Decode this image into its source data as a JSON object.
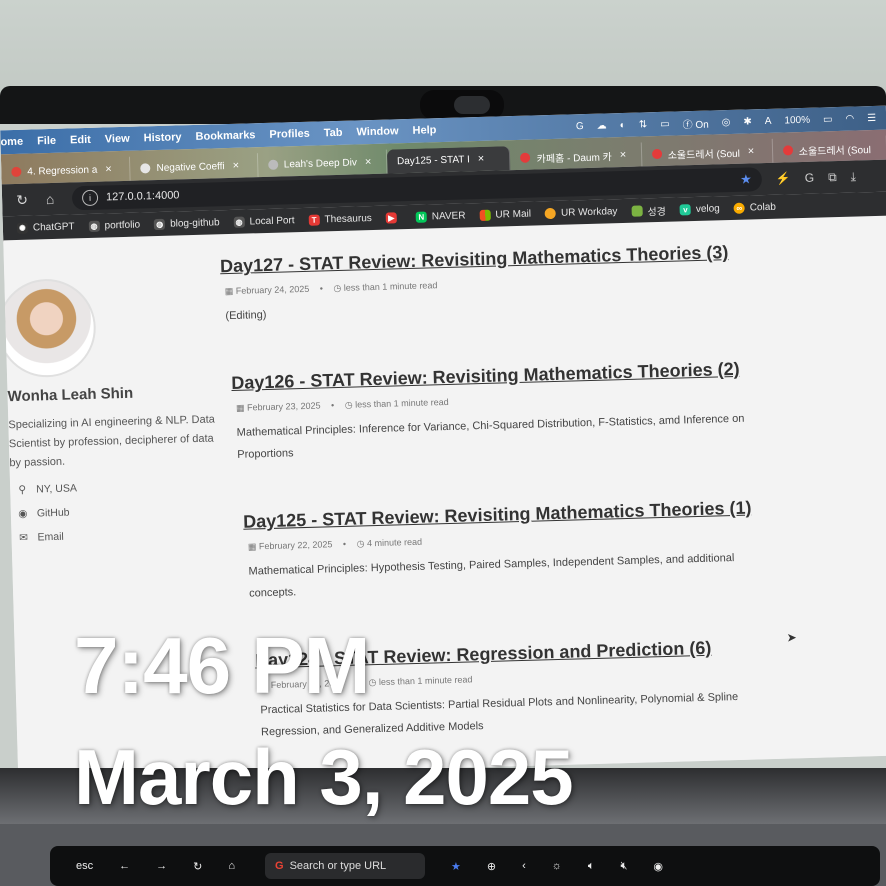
{
  "menu": [
    "ome",
    "File",
    "Edit",
    "View",
    "History",
    "Bookmarks",
    "Profiles",
    "Tab",
    "Window",
    "Help"
  ],
  "status": {
    "on": "On",
    "battery": "100%"
  },
  "tabs": [
    {
      "label": "4. Regression a",
      "color": "#e0443a"
    },
    {
      "label": "Negative Coeffi",
      "color": "#e6e6e6"
    },
    {
      "label": "Leah's Deep Div",
      "color": "#bbbbbb"
    },
    {
      "label": "Day125 - STAT I",
      "color": "#3a3b3d"
    },
    {
      "label": "카페홈 - Daum 카",
      "color": "#e33b3b"
    },
    {
      "label": "소울드레서 (Soul",
      "color": "#e33b3b"
    },
    {
      "label": "소울드레서 (Soul",
      "color": "#e33b3b"
    }
  ],
  "url": "127.0.0.1:4000",
  "bookmarks": [
    {
      "label": "ChatGPT",
      "icon": "chatgpt-icon",
      "color": "#333333"
    },
    {
      "label": "portfolio",
      "icon": "globe-icon",
      "color": "#555555"
    },
    {
      "label": "blog-github",
      "icon": "globe-icon",
      "color": "#555555"
    },
    {
      "label": "Local Port",
      "icon": "globe-icon",
      "color": "#555555"
    },
    {
      "label": "Thesaurus",
      "icon": "thesaurus-icon",
      "color": "#e53935"
    },
    {
      "label": "",
      "icon": "youtube-icon",
      "color": "#e53935"
    },
    {
      "label": "NAVER",
      "icon": "naver-icon",
      "color": "#03c75a"
    },
    {
      "label": "UR Mail",
      "icon": "microsoft-icon",
      "color": "#f25022"
    },
    {
      "label": "UR Workday",
      "icon": "workday-icon",
      "color": "#f5a623"
    },
    {
      "label": "성경",
      "icon": "bible-icon",
      "color": "#7cb342"
    },
    {
      "label": "velog",
      "icon": "velog-icon",
      "color": "#20c997"
    },
    {
      "label": "Colab",
      "icon": "colab-icon",
      "color": "#f9ab00"
    }
  ],
  "profile": {
    "name": "Wonha Leah Shin",
    "bio": "Specializing in AI engineering & NLP. Data Scientist by profession, decipherer of data by passion.",
    "location": "NY, USA",
    "github": "GitHub",
    "email": "Email"
  },
  "posts": [
    {
      "title": "Day127 - STAT Review: Revisiting Mathematics Theories (3)",
      "date": "February 24, 2025",
      "read": "less than 1 minute read",
      "excerpt": "(Editing)"
    },
    {
      "title": "Day126 - STAT Review: Revisiting Mathematics Theories (2)",
      "date": "February 23, 2025",
      "read": "less than 1 minute read",
      "excerpt": "Mathematical Principles: Inference for Variance, Chi-Squared Distribution, F-Statistics, amd Inference on Proportions"
    },
    {
      "title": "Day125 - STAT Review: Revisiting Mathematics Theories (1)",
      "date": "February 22, 2025",
      "read": "4 minute read",
      "excerpt": "Mathematical Principles: Hypothesis Testing, Paired Samples, Independent Samples, and additional concepts."
    },
    {
      "title": "Day124 - STAT Review: Regression and Prediction (6)",
      "date": "February 19, 2025",
      "read": "less than 1 minute read",
      "excerpt": "Practical Statistics for Data Scientists: Partial Residual Plots and Nonlinearity, Polynomial & Spline Regression, and Generalized Additive Models"
    }
  ],
  "overlay": {
    "time": "7:46 PM",
    "date": "March 3, 2025"
  },
  "touchbar": {
    "esc": "esc",
    "search": "Search or type URL"
  }
}
